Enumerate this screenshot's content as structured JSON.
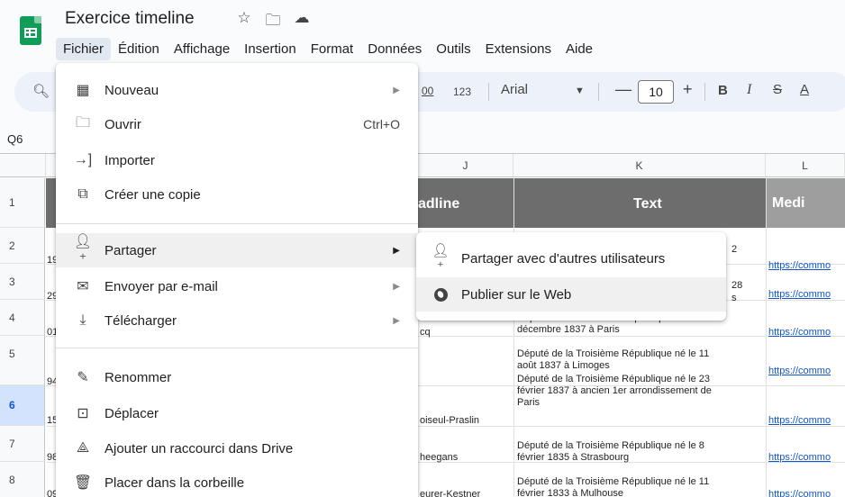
{
  "app": {
    "title": "Exercice timeline",
    "title_icons": [
      "star-icon",
      "move-to-folder-icon",
      "cloud-status-icon"
    ]
  },
  "menubar": [
    "Fichier",
    "Édition",
    "Affichage",
    "Insertion",
    "Format",
    "Données",
    "Outils",
    "Extensions",
    "Aide"
  ],
  "toolbar": {
    "decimal_label": "00",
    "format_label": "123",
    "font": "Arial",
    "font_size": "10",
    "minus": "—",
    "plus": "+",
    "bold": "B",
    "italic": "I",
    "strike": "S",
    "color": "A"
  },
  "namebox": "Q6",
  "sheet": {
    "columns": [
      "J",
      "K",
      "L"
    ],
    "rows": [
      "1",
      "2",
      "3",
      "4",
      "5",
      "6",
      "7",
      "8"
    ],
    "selected_row": "6",
    "header_cells": {
      "headline": "adline",
      "text": "Text",
      "media": "Medi"
    },
    "row_fragments": [
      "19",
      "29",
      "01",
      "94",
      "15",
      "98",
      "09"
    ],
    "k_texts": [
      "2",
      "28",
      "s",
      "Député de la Troisième République né le 24",
      "décembre 1837 à Paris",
      "Député de la Troisième République né le 11",
      "août 1837 à Limoges",
      "Député de la Troisième République né le 23",
      "février 1837 à ancien 1er arrondissement de",
      "Paris",
      "Député de la Troisième République né le 8",
      "février 1835 à Strasbourg",
      "Député de la Troisième République né le 11",
      "février 1833 à Mulhouse"
    ],
    "j_texts": [
      "cq",
      "oiseul-Praslin",
      "heegans",
      "eurer-Kestner"
    ],
    "link_text": "https://commo"
  },
  "file_menu": {
    "items": [
      {
        "label": "Nouveau",
        "icon": "new-icon",
        "shortcut": "",
        "submenu": true
      },
      {
        "label": "Ouvrir",
        "icon": "folder-icon",
        "shortcut": "Ctrl+O",
        "submenu": false
      },
      {
        "label": "Importer",
        "icon": "import-icon",
        "shortcut": "",
        "submenu": false
      },
      {
        "label": "Créer une copie",
        "icon": "copy-icon",
        "shortcut": "",
        "submenu": false
      },
      {
        "label": "Partager",
        "icon": "share-person-icon",
        "shortcut": "",
        "submenu": true
      },
      {
        "label": "Envoyer par e-mail",
        "icon": "mail-icon",
        "shortcut": "",
        "submenu": true
      },
      {
        "label": "Télécharger",
        "icon": "download-icon",
        "shortcut": "",
        "submenu": true
      },
      {
        "label": "Renommer",
        "icon": "rename-icon",
        "shortcut": "",
        "submenu": false
      },
      {
        "label": "Déplacer",
        "icon": "move-icon",
        "shortcut": "",
        "submenu": false
      },
      {
        "label": "Ajouter un raccourci dans Drive",
        "icon": "drive-shortcut-icon",
        "shortcut": "",
        "submenu": false
      },
      {
        "label": "Placer dans la corbeille",
        "icon": "trash-icon",
        "shortcut": "",
        "submenu": false
      }
    ]
  },
  "share_submenu": {
    "items": [
      {
        "label": "Partager avec d'autres utilisateurs",
        "icon": "share-person-icon"
      },
      {
        "label": "Publier sur le Web",
        "icon": "globe-icon"
      }
    ]
  }
}
